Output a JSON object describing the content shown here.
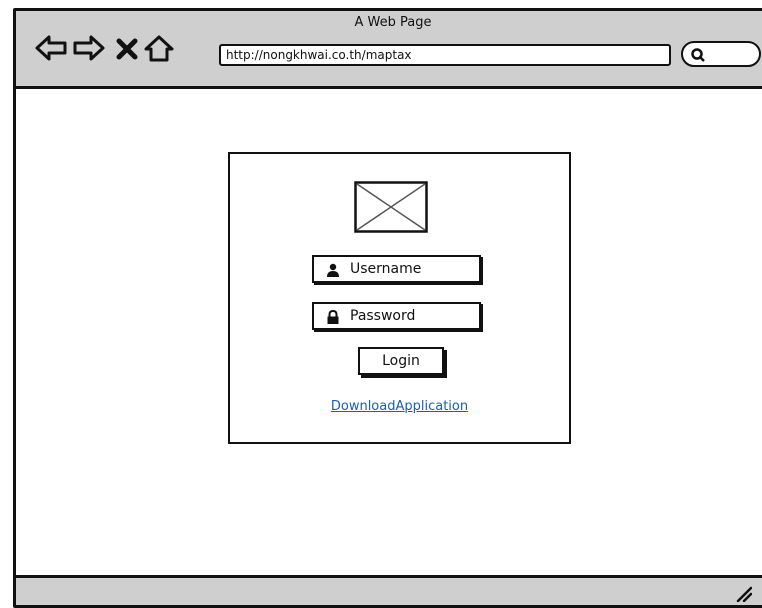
{
  "window": {
    "title": "A Web Page",
    "address": "http://nongkhwai.co.th/maptax"
  },
  "nav": {
    "icons": [
      "back-arrow-icon",
      "forward-arrow-icon",
      "stop-x-icon",
      "home-icon",
      "search-icon"
    ]
  },
  "login": {
    "username_label": "Username",
    "password_label": "Password",
    "login_label": "Login",
    "download_label": "DownloadApplication"
  },
  "colors": {
    "chrome": "#cfcfcf",
    "border": "#111111",
    "link": "#1a5fb4"
  }
}
